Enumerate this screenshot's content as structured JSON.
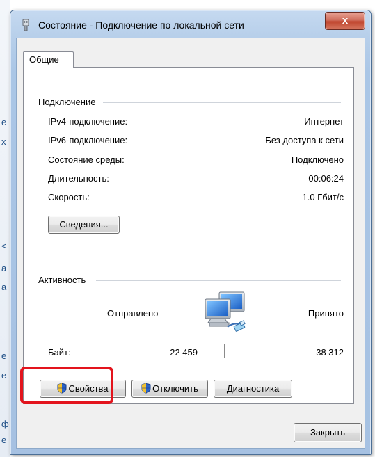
{
  "window": {
    "title": "Состояние - Подключение по локальной сети",
    "close_glyph": "x"
  },
  "background_chars": [
    "е",
    "х",
    "<",
    "а",
    "а",
    "е",
    "е",
    "ф",
    "е"
  ],
  "tabs": [
    {
      "label": "Общие"
    }
  ],
  "connection": {
    "heading": "Подключение",
    "rows": [
      {
        "label": "IPv4-подключение:",
        "value": "Интернет"
      },
      {
        "label": "IPv6-подключение:",
        "value": "Без доступа к сети"
      },
      {
        "label": "Состояние среды:",
        "value": "Подключено"
      },
      {
        "label": "Длительность:",
        "value": "00:06:24"
      },
      {
        "label": "Скорость:",
        "value": "1.0 Гбит/с"
      }
    ],
    "details_button": "Сведения..."
  },
  "activity": {
    "heading": "Активность",
    "sent_label": "Отправлено",
    "received_label": "Принято",
    "bytes_label": "Байт:",
    "bytes_sent": "22 459",
    "bytes_received": "38 312"
  },
  "buttons": {
    "properties": "Свойства",
    "disable": "Отключить",
    "diagnose": "Диагностика",
    "close": "Закрыть"
  },
  "colors": {
    "highlight": "#e3141d",
    "title_bar": "#a6c1e2",
    "close_button": "#c0462f"
  },
  "icons": {
    "title": "network-adapter-icon",
    "activity": "network-computers-icon",
    "uac": "uac-shield-icon"
  }
}
